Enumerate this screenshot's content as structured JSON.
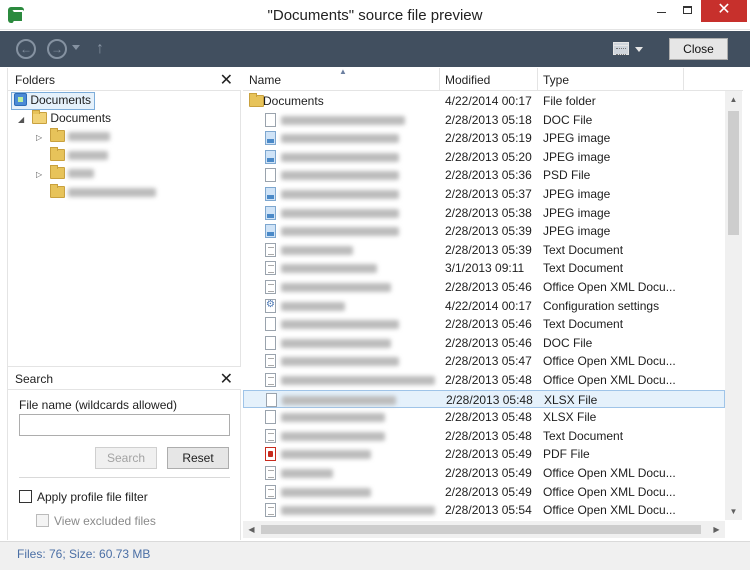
{
  "window": {
    "title": "\"Documents\" source file preview",
    "controls": {
      "minimize": "—",
      "maximize": "☐",
      "close": "✕"
    }
  },
  "toolbar": {
    "back_icon": "back-arrow-icon",
    "forward_icon": "forward-arrow-icon",
    "up_icon": "up-arrow-icon",
    "view_icon": "view-mode-icon",
    "close_label": "Close"
  },
  "folders": {
    "title": "Folders",
    "close_glyph": "✕",
    "root_label": "Documents",
    "child_label": "Documents",
    "subfolders": [
      {
        "label": "",
        "blurred": true,
        "expandable": true
      },
      {
        "label": "",
        "blurred": true,
        "expandable": false
      },
      {
        "label": "",
        "blurred": true,
        "expandable": true
      },
      {
        "label": "",
        "blurred": true,
        "expandable": false
      }
    ]
  },
  "search": {
    "title": "Search",
    "close_glyph": "✕",
    "field_label": "File name (wildcards allowed)",
    "value": "",
    "search_label": "Search",
    "reset_label": "Reset",
    "apply_filter_label": "Apply profile file filter",
    "view_excluded_label": "View excluded files",
    "apply_filter_checked": false,
    "view_excluded_checked": false
  },
  "file_list": {
    "columns": [
      "Name",
      "Modified",
      "Type"
    ],
    "rows": [
      {
        "name": "Documents",
        "blurred": false,
        "icon": "folder",
        "modified": "4/22/2014 00:17",
        "type": "File folder"
      },
      {
        "name": "",
        "blurred": true,
        "icon": "doc",
        "modified": "2/28/2013 05:18",
        "type": "DOC File"
      },
      {
        "name": "",
        "blurred": true,
        "icon": "img",
        "modified": "2/28/2013 05:19",
        "type": "JPEG image"
      },
      {
        "name": "",
        "blurred": true,
        "icon": "img",
        "modified": "2/28/2013 05:20",
        "type": "JPEG image"
      },
      {
        "name": "",
        "blurred": true,
        "icon": "doc",
        "modified": "2/28/2013 05:36",
        "type": "PSD File"
      },
      {
        "name": "",
        "blurred": true,
        "icon": "img",
        "modified": "2/28/2013 05:37",
        "type": "JPEG image"
      },
      {
        "name": "",
        "blurred": true,
        "icon": "img",
        "modified": "2/28/2013 05:38",
        "type": "JPEG image"
      },
      {
        "name": "",
        "blurred": true,
        "icon": "img",
        "modified": "2/28/2013 05:39",
        "type": "JPEG image"
      },
      {
        "name": "",
        "blurred": true,
        "icon": "txt",
        "modified": "2/28/2013 05:39",
        "type": "Text Document"
      },
      {
        "name": "",
        "blurred": true,
        "icon": "txt",
        "modified": "3/1/2013 09:11",
        "type": "Text Document"
      },
      {
        "name": "",
        "blurred": true,
        "icon": "txt",
        "modified": "2/28/2013 05:46",
        "type": "Office Open XML Docu..."
      },
      {
        "name": "",
        "blurred": true,
        "icon": "cfg",
        "modified": "4/22/2014 00:17",
        "type": "Configuration settings"
      },
      {
        "name": "",
        "blurred": true,
        "icon": "doc",
        "modified": "2/28/2013 05:46",
        "type": "Text Document"
      },
      {
        "name": "",
        "blurred": true,
        "icon": "doc",
        "modified": "2/28/2013 05:46",
        "type": "DOC File"
      },
      {
        "name": "",
        "blurred": true,
        "icon": "txt",
        "modified": "2/28/2013 05:47",
        "type": "Office Open XML Docu..."
      },
      {
        "name": "",
        "blurred": true,
        "icon": "txt",
        "modified": "2/28/2013 05:48",
        "type": "Office Open XML Docu..."
      },
      {
        "name": "",
        "blurred": true,
        "icon": "doc",
        "modified": "2/28/2013 05:48",
        "type": "XLSX File",
        "selected": true
      },
      {
        "name": "",
        "blurred": true,
        "icon": "doc",
        "modified": "2/28/2013 05:48",
        "type": "XLSX File"
      },
      {
        "name": "",
        "blurred": true,
        "icon": "txt",
        "modified": "2/28/2013 05:48",
        "type": "Text Document"
      },
      {
        "name": "",
        "blurred": true,
        "icon": "pdf",
        "modified": "2/28/2013 05:49",
        "type": "PDF File"
      },
      {
        "name": "",
        "blurred": true,
        "icon": "txt",
        "modified": "2/28/2013 05:49",
        "type": "Office Open XML Docu..."
      },
      {
        "name": "",
        "blurred": true,
        "icon": "txt",
        "modified": "2/28/2013 05:49",
        "type": "Office Open XML Docu..."
      },
      {
        "name": "",
        "blurred": true,
        "icon": "txt",
        "modified": "2/28/2013 05:54",
        "type": "Office Open XML Docu..."
      }
    ]
  },
  "status": {
    "text": "Files: 76; Size: 60.73 MB"
  },
  "colors": {
    "toolbar_bg": "#414f5f",
    "close_button": "#c7302c",
    "selection": "#e5f1fb",
    "status_text": "#4b6fa5"
  }
}
